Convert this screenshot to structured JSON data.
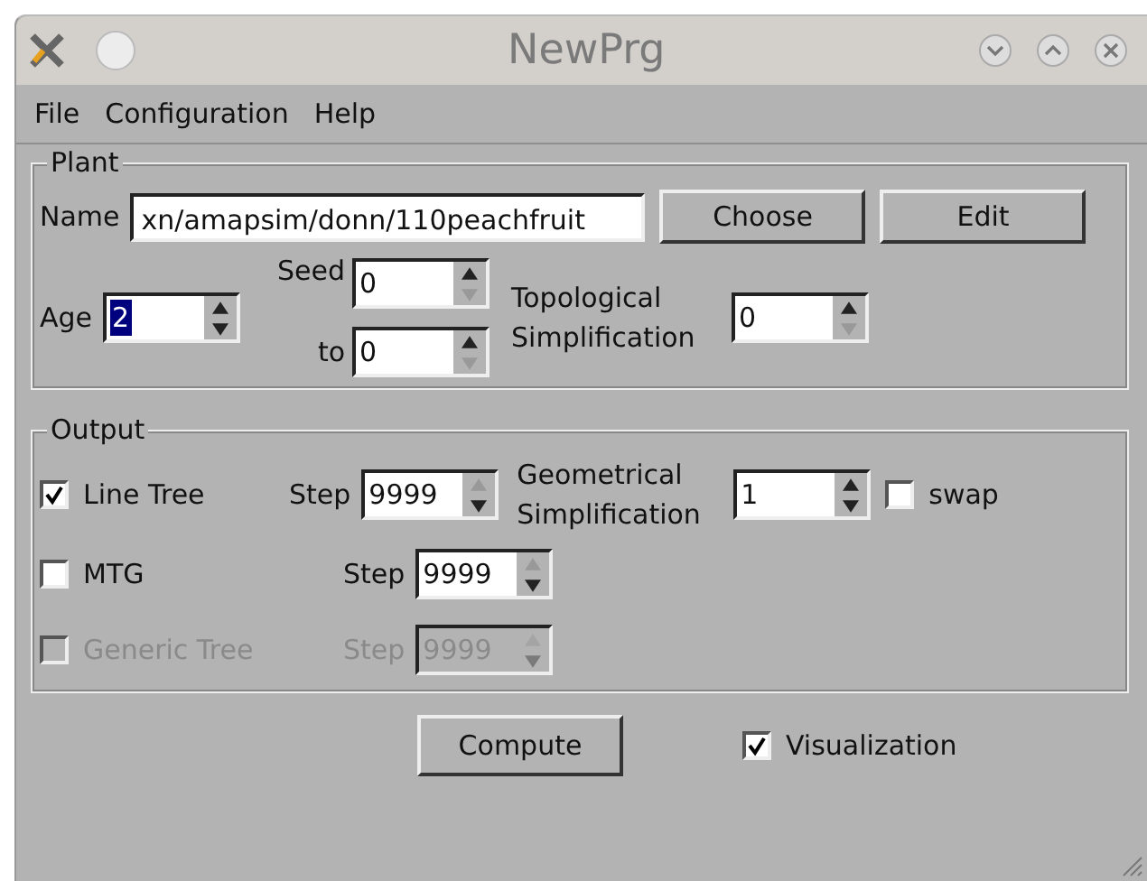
{
  "window": {
    "title": "NewPrg"
  },
  "menu": [
    {
      "label": "File"
    },
    {
      "label": "Configuration"
    },
    {
      "label": "Help"
    }
  ],
  "plant": {
    "legend": "Plant",
    "name_label": "Name",
    "name_value": "xn/amapsim/donn/110peachfruit",
    "buttons": [
      "Choose",
      "Edit"
    ],
    "age": {
      "label": "Age",
      "value": "2",
      "value_selected": true,
      "up_enabled": true,
      "down_enabled": true
    },
    "seed": {
      "label": "Seed",
      "value": "0",
      "value_selected": false,
      "up_enabled": true,
      "down_enabled": false
    },
    "seed_to": {
      "label": "to",
      "value": "0",
      "value_selected": false,
      "up_enabled": true,
      "down_enabled": false
    },
    "topological": {
      "label": "Topological Simplification",
      "value": "0",
      "value_selected": false,
      "up_enabled": true,
      "down_enabled": false
    }
  },
  "output": {
    "legend": "Output",
    "rows": [
      {
        "label": "Line Tree",
        "checked": true,
        "disabled": false,
        "step_label": "Step",
        "step": {
          "value": "9999",
          "value_selected": false,
          "up_enabled": false,
          "down_enabled": true
        },
        "geometrical": {
          "label": "Geometrical Simplification",
          "value": "1",
          "value_selected": false,
          "up_enabled": true,
          "down_enabled": true
        },
        "swap": {
          "label": "swap",
          "checked": false
        }
      },
      {
        "label": "MTG",
        "checked": false,
        "disabled": false,
        "step_label": "Step",
        "step": {
          "value": "9999",
          "value_selected": false,
          "up_enabled": false,
          "down_enabled": true
        }
      },
      {
        "label": "Generic Tree",
        "checked": false,
        "disabled": true,
        "step_label": "Step",
        "step": {
          "value": "9999",
          "value_selected": false,
          "up_enabled": false,
          "down_enabled": true
        }
      }
    ]
  },
  "compute": "Compute",
  "visualization": {
    "label": "Visualization",
    "checked": true
  }
}
